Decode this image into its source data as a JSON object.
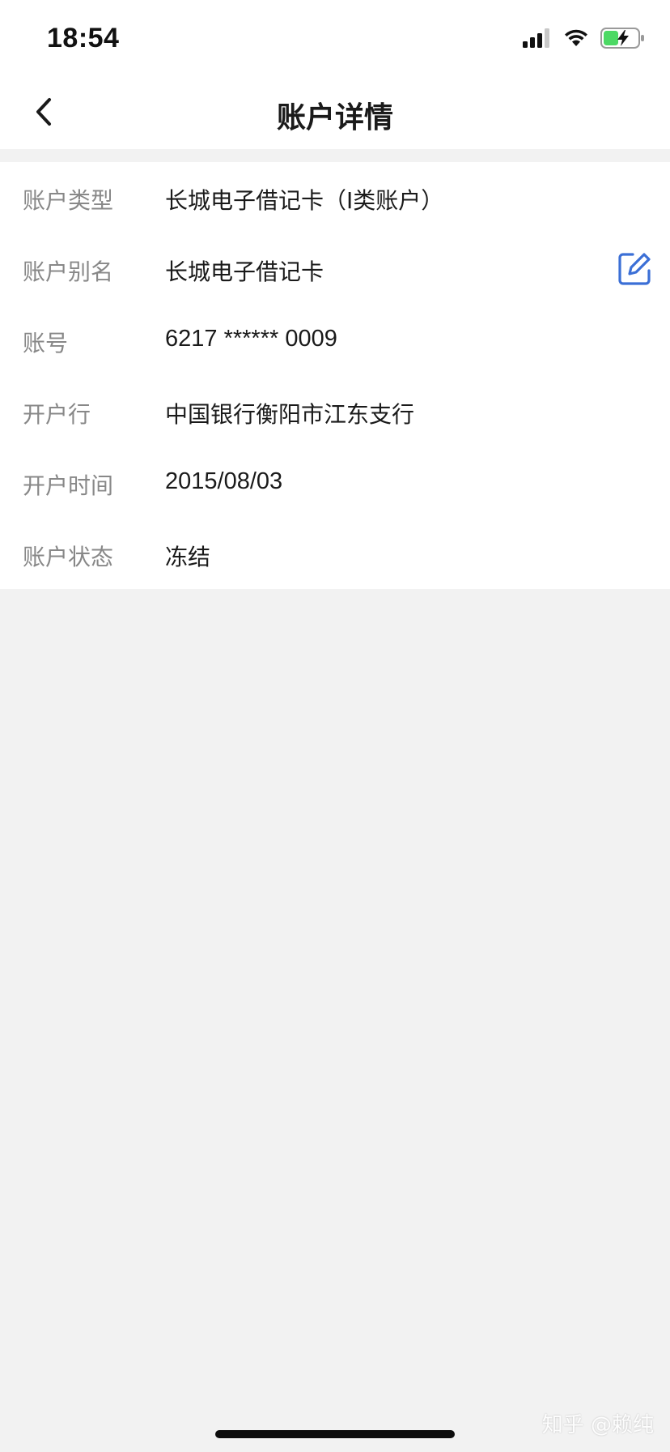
{
  "status_bar": {
    "time": "18:54",
    "icons": [
      "cellular-signal-icon",
      "wifi-icon",
      "battery-charging-icon"
    ],
    "battery_color": "#4cd964"
  },
  "nav": {
    "title": "账户详情",
    "back_icon": "chevron-left-icon"
  },
  "details": {
    "rows": [
      {
        "label": "账户类型",
        "value": "长城电子借记卡（I类账户）"
      },
      {
        "label": "账户别名",
        "value": "长城电子借记卡"
      },
      {
        "label": "账号",
        "value": "6217 ****** 0009"
      },
      {
        "label": "开户行",
        "value": "中国银行衡阳市江东支行"
      },
      {
        "label": "开户时间",
        "value": "2015/08/03"
      },
      {
        "label": "账户状态",
        "value": "冻结"
      }
    ],
    "edit_icon": "edit-icon",
    "accent_color": "#3b6fd6"
  },
  "watermark": "知乎 @赖纯"
}
